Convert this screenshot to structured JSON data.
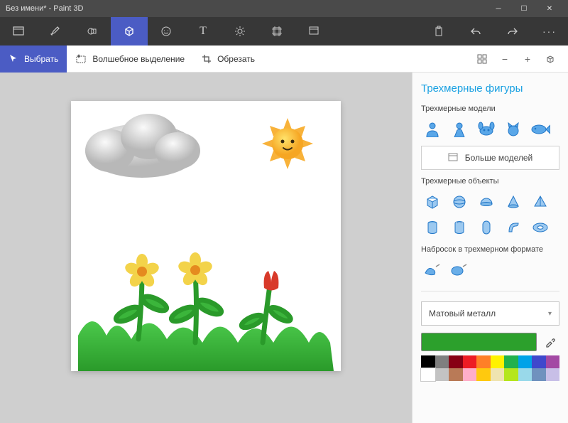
{
  "window": {
    "title": "Без имени* - Paint 3D"
  },
  "main_toolbar": {
    "items": [
      "menu",
      "brushes",
      "2d",
      "3d",
      "stickers",
      "text",
      "effects",
      "canvas",
      "library",
      "",
      "paste",
      "undo",
      "redo",
      "more"
    ],
    "active_index": 3
  },
  "sub_toolbar": {
    "select": "Выбрать",
    "magic_select": "Волшебное выделение",
    "crop": "Обрезать"
  },
  "panel": {
    "title": "Трехмерные фигуры",
    "section_models": "Трехмерные модели",
    "more_models": "Больше моделей",
    "section_objects": "Трехмерные объекты",
    "section_sketch": "Набросок в трехмерном формате",
    "material_label": "Матовый металл"
  },
  "palette_colors": [
    "#000000",
    "#7f7f7f",
    "#870014",
    "#ed1c24",
    "#ff7f27",
    "#fff200",
    "#22b14c",
    "#00a2e8",
    "#3f48cc",
    "#a349a4",
    "#ffffff",
    "#c3c3c3",
    "#b97a57",
    "#ffaec9",
    "#ffc90e",
    "#efe4b0",
    "#b5e61d",
    "#99d9ea",
    "#7092be",
    "#c8bfe7"
  ],
  "current_color": "#2ca02c"
}
